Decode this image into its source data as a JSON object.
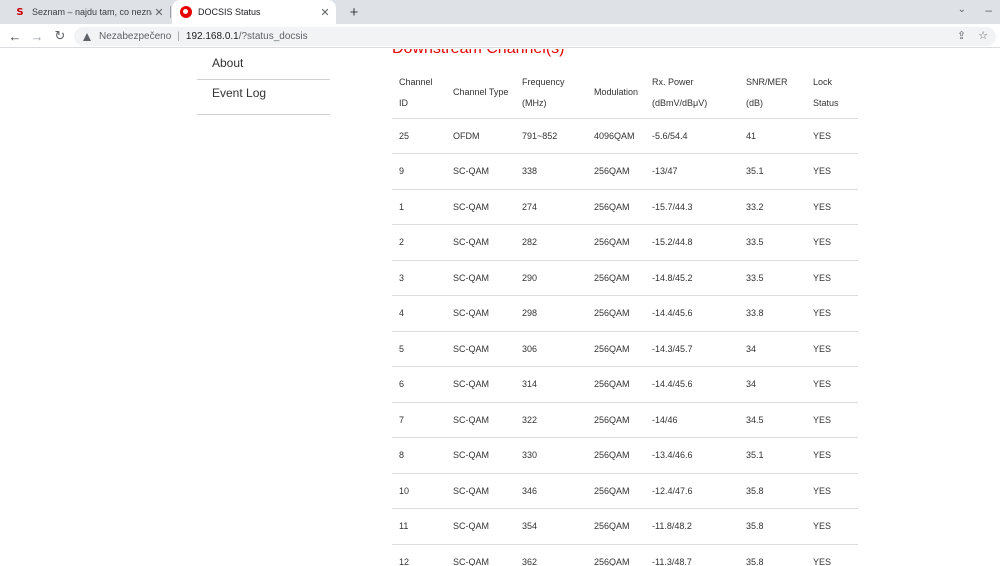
{
  "browser": {
    "tabs": [
      {
        "title": "Seznam – najdu tam, co neznám",
        "favicon": "seznam-s-icon",
        "close": "✕"
      },
      {
        "title": "DOCSIS Status",
        "favicon": "vodafone-icon",
        "close": "✕"
      }
    ],
    "new_tab": "+",
    "address": {
      "security_label": "Nezabezpečeno",
      "separator": "|",
      "host": "192.168.0.1",
      "path": "/?status_docsis"
    }
  },
  "sidebar": {
    "items": [
      {
        "label": "About"
      },
      {
        "label": "Event Log"
      }
    ]
  },
  "heading": "Downstream Channel(s)",
  "table": {
    "headers": {
      "channel_id": [
        "Channel",
        "ID"
      ],
      "channel_type": "Channel Type",
      "frequency": [
        "Frequency",
        "(MHz)"
      ],
      "modulation": "Modulation",
      "rx_power": [
        "Rx. Power",
        "(dBmV/dBμV)"
      ],
      "snr_mer": [
        "SNR/MER",
        "(dB)"
      ],
      "lock_status": [
        "Lock",
        "Status"
      ]
    },
    "rows": [
      {
        "id": "25",
        "type": "OFDM",
        "freq": "791~852",
        "mod": "4096QAM",
        "rx": "-5.6/54.4",
        "snr": "41",
        "lock": "YES"
      },
      {
        "id": "9",
        "type": "SC-QAM",
        "freq": "338",
        "mod": "256QAM",
        "rx": "-13/47",
        "snr": "35.1",
        "lock": "YES"
      },
      {
        "id": "1",
        "type": "SC-QAM",
        "freq": "274",
        "mod": "256QAM",
        "rx": "-15.7/44.3",
        "snr": "33.2",
        "lock": "YES"
      },
      {
        "id": "2",
        "type": "SC-QAM",
        "freq": "282",
        "mod": "256QAM",
        "rx": "-15.2/44.8",
        "snr": "33.5",
        "lock": "YES"
      },
      {
        "id": "3",
        "type": "SC-QAM",
        "freq": "290",
        "mod": "256QAM",
        "rx": "-14.8/45.2",
        "snr": "33.5",
        "lock": "YES"
      },
      {
        "id": "4",
        "type": "SC-QAM",
        "freq": "298",
        "mod": "256QAM",
        "rx": "-14.4/45.6",
        "snr": "33.8",
        "lock": "YES"
      },
      {
        "id": "5",
        "type": "SC-QAM",
        "freq": "306",
        "mod": "256QAM",
        "rx": "-14.3/45.7",
        "snr": "34",
        "lock": "YES"
      },
      {
        "id": "6",
        "type": "SC-QAM",
        "freq": "314",
        "mod": "256QAM",
        "rx": "-14.4/45.6",
        "snr": "34",
        "lock": "YES"
      },
      {
        "id": "7",
        "type": "SC-QAM",
        "freq": "322",
        "mod": "256QAM",
        "rx": "-14/46",
        "snr": "34.5",
        "lock": "YES"
      },
      {
        "id": "8",
        "type": "SC-QAM",
        "freq": "330",
        "mod": "256QAM",
        "rx": "-13.4/46.6",
        "snr": "35.1",
        "lock": "YES"
      },
      {
        "id": "10",
        "type": "SC-QAM",
        "freq": "346",
        "mod": "256QAM",
        "rx": "-12.4/47.6",
        "snr": "35.8",
        "lock": "YES"
      },
      {
        "id": "11",
        "type": "SC-QAM",
        "freq": "354",
        "mod": "256QAM",
        "rx": "-11.8/48.2",
        "snr": "35.8",
        "lock": "YES"
      },
      {
        "id": "12",
        "type": "SC-QAM",
        "freq": "362",
        "mod": "256QAM",
        "rx": "-11.3/48.7",
        "snr": "35.8",
        "lock": "YES"
      }
    ]
  },
  "colors": {
    "accent": "#e60000",
    "text": "#333333",
    "row_border": "#dddddd"
  }
}
